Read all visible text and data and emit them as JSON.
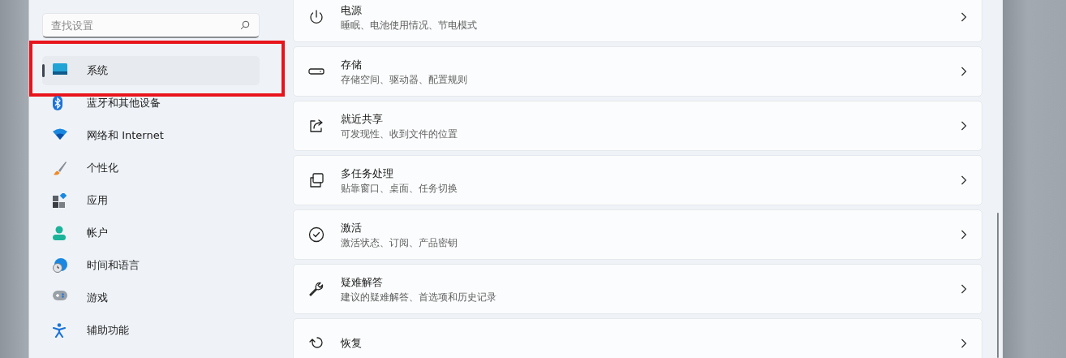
{
  "search": {
    "placeholder": "查找设置"
  },
  "nav": [
    {
      "label": "系统",
      "kind": "system",
      "selected": true,
      "highlighted": true
    },
    {
      "label": "蓝牙和其他设备",
      "kind": "bluetooth",
      "selected": false,
      "highlighted": false
    },
    {
      "label": "网络和 Internet",
      "kind": "wifi",
      "selected": false,
      "highlighted": false
    },
    {
      "label": "个性化",
      "kind": "brush",
      "selected": false,
      "highlighted": false
    },
    {
      "label": "应用",
      "kind": "apps",
      "selected": false,
      "highlighted": false
    },
    {
      "label": "帐户",
      "kind": "person",
      "selected": false,
      "highlighted": false
    },
    {
      "label": "时间和语言",
      "kind": "clock",
      "selected": false,
      "highlighted": false
    },
    {
      "label": "游戏",
      "kind": "gamepad",
      "selected": false,
      "highlighted": false
    },
    {
      "label": "辅助功能",
      "kind": "accessibility",
      "selected": false,
      "highlighted": false
    }
  ],
  "settings": [
    {
      "title": "电源",
      "subtitle": "睡眠、电池使用情况、节电模式",
      "kind": "power"
    },
    {
      "title": "存储",
      "subtitle": "存储空间、驱动器、配置规则",
      "kind": "storage"
    },
    {
      "title": "就近共享",
      "subtitle": "可发现性、收到文件的位置",
      "kind": "share"
    },
    {
      "title": "多任务处理",
      "subtitle": "贴靠窗口、桌面、任务切换",
      "kind": "windows"
    },
    {
      "title": "激活",
      "subtitle": "激活状态、订阅、产品密钥",
      "kind": "check"
    },
    {
      "title": "疑难解答",
      "subtitle": "建议的疑难解答、首选项和历史记录",
      "kind": "wrench"
    },
    {
      "title": "恢复",
      "kind": "restore"
    }
  ]
}
